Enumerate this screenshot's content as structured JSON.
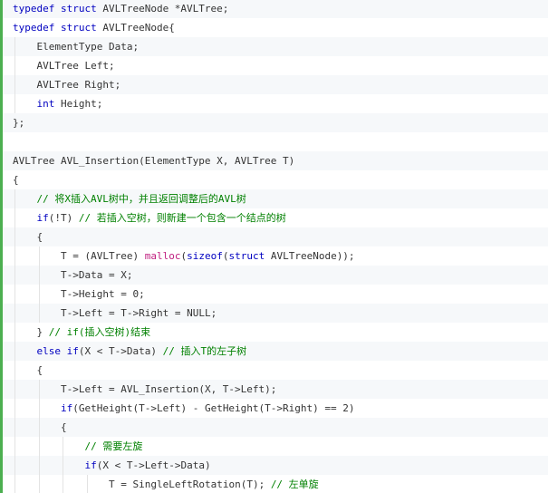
{
  "colors": {
    "keyword": "#0000c0",
    "function_highlight": "#c02080",
    "comment": "#008000",
    "text": "#333333",
    "accent_border": "#4caf50",
    "line_bg_a": "#f6f8fa",
    "line_bg_b": "#ffffff"
  },
  "code_lines": [
    {
      "indent": 0,
      "tokens": [
        {
          "t": "kw",
          "v": "typedef struct"
        },
        {
          "t": "tx",
          "v": " AVLTreeNode *AVLTree;"
        }
      ]
    },
    {
      "indent": 0,
      "tokens": [
        {
          "t": "kw",
          "v": "typedef struct"
        },
        {
          "t": "tx",
          "v": " AVLTreeNode{"
        }
      ]
    },
    {
      "indent": 1,
      "tokens": [
        {
          "t": "tx",
          "v": "ElementType Data;"
        }
      ]
    },
    {
      "indent": 1,
      "tokens": [
        {
          "t": "tx",
          "v": "AVLTree Left;"
        }
      ]
    },
    {
      "indent": 1,
      "tokens": [
        {
          "t": "tx",
          "v": "AVLTree Right;"
        }
      ]
    },
    {
      "indent": 1,
      "tokens": [
        {
          "t": "kw",
          "v": "int"
        },
        {
          "t": "tx",
          "v": " Height;"
        }
      ]
    },
    {
      "indent": 0,
      "tokens": [
        {
          "t": "tx",
          "v": "};"
        }
      ]
    },
    {
      "indent": 0,
      "tokens": []
    },
    {
      "indent": 0,
      "tokens": [
        {
          "t": "tx",
          "v": "AVLTree AVL_Insertion(ElementType X, AVLTree T)"
        }
      ]
    },
    {
      "indent": 0,
      "tokens": [
        {
          "t": "tx",
          "v": "{"
        }
      ]
    },
    {
      "indent": 1,
      "tokens": [
        {
          "t": "cm",
          "v": "// 将X插入AVL树中，并且返回调整后的AVL树"
        }
      ]
    },
    {
      "indent": 1,
      "tokens": [
        {
          "t": "kw",
          "v": "if"
        },
        {
          "t": "tx",
          "v": "(!T) "
        },
        {
          "t": "cm",
          "v": "// 若插入空树，则新建一个包含一个结点的树"
        }
      ]
    },
    {
      "indent": 1,
      "tokens": [
        {
          "t": "tx",
          "v": "{"
        }
      ]
    },
    {
      "indent": 2,
      "tokens": [
        {
          "t": "tx",
          "v": "T = (AVLTree) "
        },
        {
          "t": "fn",
          "v": "malloc"
        },
        {
          "t": "tx",
          "v": "("
        },
        {
          "t": "kw",
          "v": "sizeof"
        },
        {
          "t": "tx",
          "v": "("
        },
        {
          "t": "kw",
          "v": "struct"
        },
        {
          "t": "tx",
          "v": " AVLTreeNode));"
        }
      ]
    },
    {
      "indent": 2,
      "tokens": [
        {
          "t": "tx",
          "v": "T->Data = X;"
        }
      ]
    },
    {
      "indent": 2,
      "tokens": [
        {
          "t": "tx",
          "v": "T->Height = 0;"
        }
      ]
    },
    {
      "indent": 2,
      "tokens": [
        {
          "t": "tx",
          "v": "T->Left = T->Right = NULL;"
        }
      ]
    },
    {
      "indent": 1,
      "tokens": [
        {
          "t": "tx",
          "v": "} "
        },
        {
          "t": "cm",
          "v": "// if(插入空树)结束"
        }
      ]
    },
    {
      "indent": 1,
      "tokens": [
        {
          "t": "kw",
          "v": "else if"
        },
        {
          "t": "tx",
          "v": "(X < T->Data) "
        },
        {
          "t": "cm",
          "v": "// 插入T的左子树"
        }
      ]
    },
    {
      "indent": 1,
      "tokens": [
        {
          "t": "tx",
          "v": "{"
        }
      ]
    },
    {
      "indent": 2,
      "tokens": [
        {
          "t": "tx",
          "v": "T->Left = AVL_Insertion(X, T->Left);"
        }
      ]
    },
    {
      "indent": 2,
      "tokens": [
        {
          "t": "kw",
          "v": "if"
        },
        {
          "t": "tx",
          "v": "(GetHeight(T->Left) - GetHeight(T->Right) == 2)"
        }
      ]
    },
    {
      "indent": 2,
      "tokens": [
        {
          "t": "tx",
          "v": "{"
        }
      ]
    },
    {
      "indent": 3,
      "tokens": [
        {
          "t": "cm",
          "v": "// 需要左旋"
        }
      ]
    },
    {
      "indent": 3,
      "tokens": [
        {
          "t": "kw",
          "v": "if"
        },
        {
          "t": "tx",
          "v": "(X < T->Left->Data)"
        }
      ]
    },
    {
      "indent": 4,
      "tokens": [
        {
          "t": "tx",
          "v": "T = SingleLeftRotation(T); "
        },
        {
          "t": "cm",
          "v": "// 左单旋"
        }
      ]
    }
  ]
}
